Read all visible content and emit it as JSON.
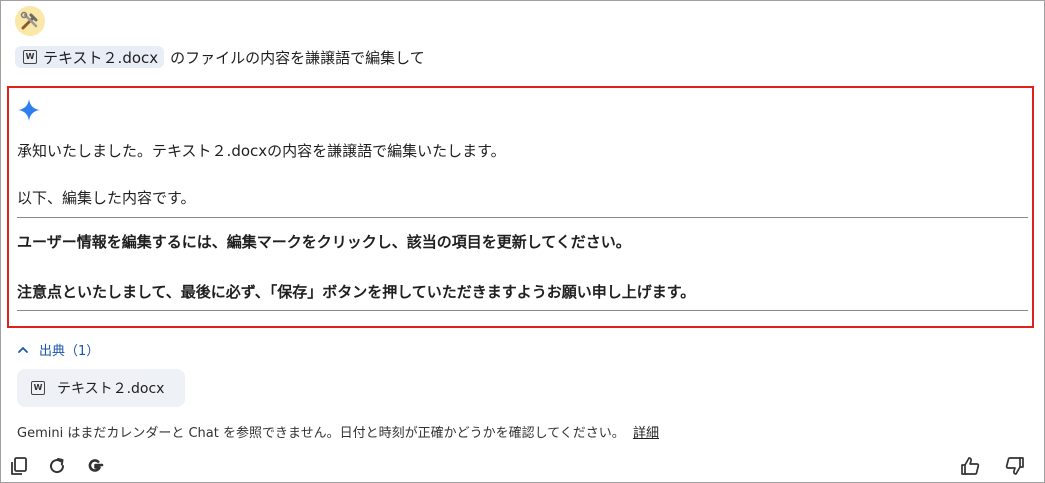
{
  "prompt": {
    "file_chip": "テキスト２.docx",
    "text": "のファイルの内容を謙譲語で編集して"
  },
  "response": {
    "line1": "承知いたしました。テキスト２.docxの内容を謙譲語で編集いたします。",
    "line2": "以下、編集した内容です。",
    "bold1": "ユーザー情報を編集するには、編集マークをクリックし、該当の項目を更新してください。",
    "bold2": "注意点といたしまして、最後に必ず、「保存」ボタンを押していただきますようお願い申し上げます。"
  },
  "sources": {
    "label": "出典（1）",
    "items": [
      {
        "name": "テキスト２.docx"
      }
    ]
  },
  "disclaimer": {
    "text": "Gemini はまだカレンダーと Chat を参照できません。日付と時刻が正確かどうかを確認してください。",
    "link": "詳細"
  },
  "icons": {
    "avatar": "user-avatar-tools-icon",
    "word": "word-file-icon",
    "sparkle": "gemini-sparkle-icon",
    "chevron": "chevron-up-icon",
    "copy": "copy-icon",
    "regenerate": "regenerate-icon",
    "google": "google-search-icon",
    "thumbs_up": "thumbs-up-icon",
    "thumbs_down": "thumbs-down-icon"
  },
  "colors": {
    "highlight_border": "#e0201b",
    "link_blue": "#1a56b0",
    "sparkle_blue": "#2f7ef0",
    "chip_bg": "#e9eef6"
  }
}
